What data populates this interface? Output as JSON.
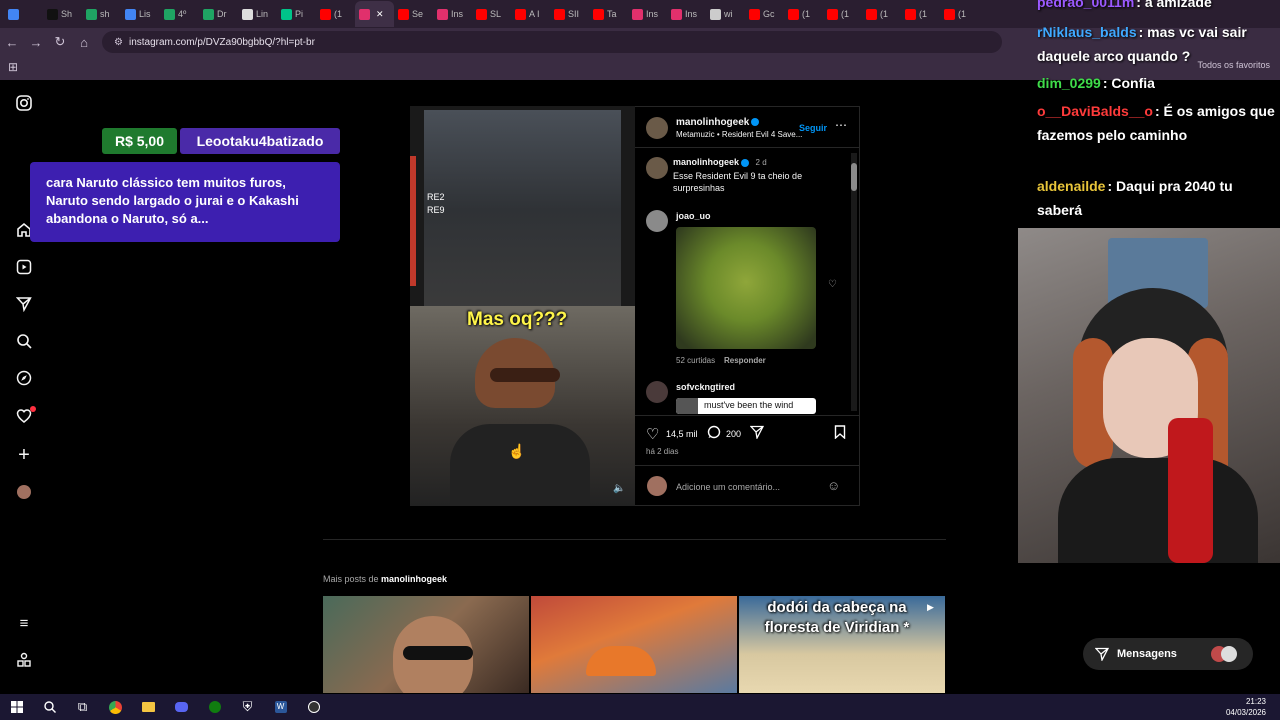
{
  "browser": {
    "tabs": [
      {
        "label": "",
        "color": "#4285f4"
      },
      {
        "label": "Sh",
        "color": "#111111"
      },
      {
        "label": "sh",
        "color": "#1fa463"
      },
      {
        "label": "Lis",
        "color": "#4285f4"
      },
      {
        "label": "4º",
        "color": "#1fa463"
      },
      {
        "label": "Dr",
        "color": "#1fa463"
      },
      {
        "label": "Lin",
        "color": "#dddddd"
      },
      {
        "label": "Pi",
        "color": "#00c389"
      },
      {
        "label": "(1",
        "color": "#ff0000"
      },
      {
        "label": "",
        "color": "#e1306c",
        "active": true
      },
      {
        "label": "Se",
        "color": "#ff0000"
      },
      {
        "label": "Ins",
        "color": "#e1306c"
      },
      {
        "label": "SL",
        "color": "#ff0000"
      },
      {
        "label": "A I",
        "color": "#ff0000"
      },
      {
        "label": "SII",
        "color": "#ff0000"
      },
      {
        "label": "Ta",
        "color": "#ff0000"
      },
      {
        "label": "Ins",
        "color": "#e1306c"
      },
      {
        "label": "Ins",
        "color": "#e1306c"
      },
      {
        "label": "wi",
        "color": "#cccccc"
      },
      {
        "label": "Gc",
        "color": "#ff0000"
      },
      {
        "label": "(1",
        "color": "#ff0000"
      },
      {
        "label": "(1",
        "color": "#ff0000"
      },
      {
        "label": "(1",
        "color": "#ff0000"
      },
      {
        "label": "(1",
        "color": "#ff0000"
      },
      {
        "label": "(1",
        "color": "#ff0000"
      }
    ],
    "url": "instagram.com/p/DVZa90bgbbQ/?hl=pt-br",
    "favorites_label": "Todos os favoritos"
  },
  "donation": {
    "amount": "R$ 5,00",
    "user": "Leootaku4batizado",
    "message": "cara Naruto clássico tem muitos furos, Naruto sendo largado o jurai e o Kakashi abandona o Naruto, só a..."
  },
  "post": {
    "media_caption": "Mas oq???",
    "media_label_top": "RE2",
    "media_label_bottom": "RE9",
    "author": "manolinhogeek",
    "follow_label": "Seguir",
    "subtitle": "Metamuzic • Resident Evil 4 Save...",
    "caption_author": "manolinhogeek",
    "caption_age": "2 d",
    "caption_text": "Esse Resident Evil 9 ta cheio de surpresinhas",
    "comment1_user": "joao_uo",
    "comment1_likes": "52 curtidas",
    "comment1_reply": "Responder",
    "comment2_user": "sofvckngtired",
    "comment2_text": "must've been the wind",
    "likes": "14,5 mil",
    "comments_count": "200",
    "posted_ago": "há 2 dias",
    "add_comment_placeholder": "Adicione um comentário..."
  },
  "more_posts": {
    "label_prefix": "Mais posts de",
    "label_user": "manolinhogeek",
    "thumb3_caption": "dodói da cabeça na floresta de Viridian *"
  },
  "chat": [
    {
      "user": "pedrao_0011m",
      "text": ": a amizade",
      "color": "#9b59ff"
    },
    {
      "user": "rNiklaus_balds",
      "text": ": mas vc vai sair daquele arco quando ?",
      "color": "#3fa9ff"
    },
    {
      "user": "dim_0299",
      "text": ": Confia",
      "color": "#3fdc4a"
    },
    {
      "user": "o__DaviBalds__o",
      "text": ": É os amigos que fazemos pelo caminho",
      "color": "#ff3b3b"
    },
    {
      "user": "aldenailde",
      "text": ": Daqui pra 2040 tu saberá",
      "color": "#e8c53a"
    }
  ],
  "messages_label": "Mensagens",
  "taskbar": {
    "time": "21:23",
    "date": "04/03/2026"
  }
}
